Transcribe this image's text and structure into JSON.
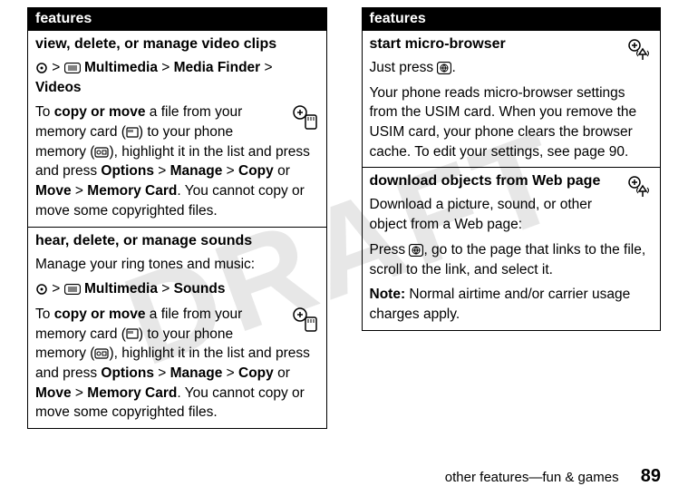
{
  "watermark": "DRAFT",
  "left_column": {
    "header": "features",
    "section1": {
      "title": "view, delete, or manage video clips",
      "nav": {
        "parts": [
          "Multimedia",
          "Media Finder",
          "Videos"
        ]
      },
      "para1_prefix": "To ",
      "para1_bold": "copy or move",
      "para1_rest": " a file from your memory card (",
      "para1_mid": ") to your phone memory (",
      "para1_after": "), highlight it in the list and press and press ",
      "opt1": "Options",
      "opt2": "Manage",
      "opt3": "Copy",
      "opt_or": " or ",
      "opt4": "Move",
      "opt5": "Memory Card",
      "para1_end": ". You cannot copy or move some copyrighted files."
    },
    "section2": {
      "title": "hear, delete, or manage sounds",
      "intro": "Manage your ring tones and music:",
      "nav": {
        "parts": [
          "Multimedia",
          "Sounds"
        ]
      },
      "para1_prefix": "To ",
      "para1_bold": "copy or move",
      "para1_rest": " a file from your memory card (",
      "para1_mid": ") to your phone memory (",
      "para1_after": "), highlight it in the list and press and press ",
      "opt1": "Options",
      "opt2": "Manage",
      "opt3": "Copy",
      "opt_or": " or ",
      "opt4": "Move",
      "opt5": "Memory Card",
      "para1_end": ". You cannot copy or move some copyrighted files."
    }
  },
  "right_column": {
    "header": "features",
    "section1": {
      "title": "start micro-browser",
      "para1_pre": "Just press ",
      "para1_post": ".",
      "para2": "Your phone reads micro-browser settings from the USIM card. When you remove the USIM card, your phone clears the browser cache. To edit your settings, see page 90."
    },
    "section2": {
      "title": "download objects from Web page",
      "para1": "Download a picture, sound, or other object from a Web page:",
      "para2_pre": "Press ",
      "para2_post": ", go to the page that links to the file, scroll to the link, and select it.",
      "note_label": "Note:",
      "note_text": " Normal airtime and/or carrier usage charges apply."
    }
  },
  "footer": {
    "text": "other features—fun & games",
    "page": "89"
  }
}
